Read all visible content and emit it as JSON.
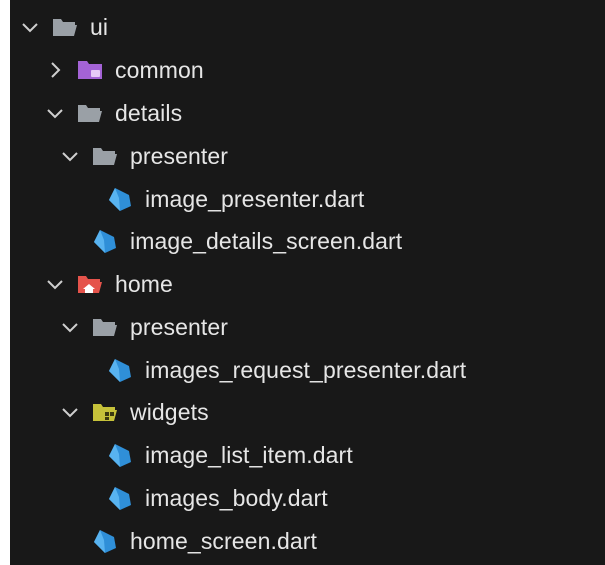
{
  "explorer": {
    "items": [
      {
        "label": "ui",
        "kind": "folder",
        "expanded": true,
        "depth": 0
      },
      {
        "label": "common",
        "kind": "folder-common",
        "expanded": false,
        "depth": 1
      },
      {
        "label": "details",
        "kind": "folder",
        "expanded": true,
        "depth": 1
      },
      {
        "label": "presenter",
        "kind": "folder",
        "expanded": true,
        "depth": 2
      },
      {
        "label": "image_presenter.dart",
        "kind": "dart-file",
        "depth": 3
      },
      {
        "label": "image_details_screen.dart",
        "kind": "dart-file",
        "depth": 2
      },
      {
        "label": "home",
        "kind": "folder-home",
        "expanded": true,
        "depth": 1
      },
      {
        "label": "presenter",
        "kind": "folder",
        "expanded": true,
        "depth": 2
      },
      {
        "label": "images_request_presenter.dart",
        "kind": "dart-file",
        "depth": 3
      },
      {
        "label": "widgets",
        "kind": "folder-widgets",
        "expanded": true,
        "depth": 2
      },
      {
        "label": "image_list_item.dart",
        "kind": "dart-file",
        "depth": 3
      },
      {
        "label": "images_body.dart",
        "kind": "dart-file",
        "depth": 3
      },
      {
        "label": "home_screen.dart",
        "kind": "dart-file",
        "depth": 2
      }
    ]
  },
  "colors": {
    "background": "#181818",
    "text": "#e6e6e6",
    "chevron": "#cfcfcf",
    "folder": "#9aa0a6",
    "folder_common": "#a463d6",
    "folder_home": "#e5534b",
    "folder_widgets": "#c6c23a",
    "dart": "#2f8fd8"
  },
  "icons": {
    "chevron_expanded": "chevron-down-icon",
    "chevron_collapsed": "chevron-right-icon",
    "folder": "folder-open-icon",
    "folder_common": "folder-common-icon",
    "folder_home": "folder-home-icon",
    "folder_widgets": "folder-widgets-icon",
    "dart": "dart-file-icon"
  }
}
